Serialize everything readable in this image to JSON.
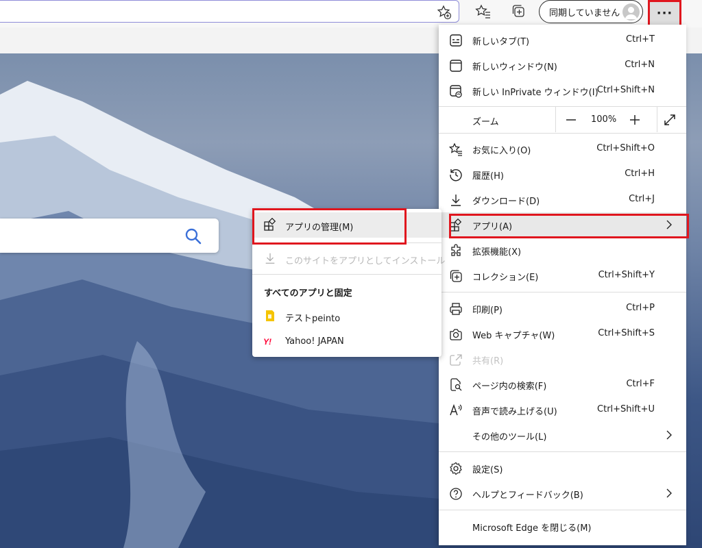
{
  "toolbar": {
    "profile_label": "同期していません",
    "more_label": "···"
  },
  "menu": {
    "new_tab": {
      "label": "新しいタブ(T)",
      "shortcut": "Ctrl+T"
    },
    "new_window": {
      "label": "新しいウィンドウ(N)",
      "shortcut": "Ctrl+N"
    },
    "new_inprivate": {
      "label": "新しい InPrivate ウィンドウ(I)",
      "shortcut": "Ctrl+Shift+N"
    },
    "zoom": {
      "label": "ズーム",
      "value": "100%"
    },
    "favorites": {
      "label": "お気に入り(O)",
      "shortcut": "Ctrl+Shift+O"
    },
    "history": {
      "label": "履歴(H)",
      "shortcut": "Ctrl+H"
    },
    "downloads": {
      "label": "ダウンロード(D)",
      "shortcut": "Ctrl+J"
    },
    "apps": {
      "label": "アプリ(A)"
    },
    "extensions": {
      "label": "拡張機能(X)"
    },
    "collections": {
      "label": "コレクション(E)",
      "shortcut": "Ctrl+Shift+Y"
    },
    "print": {
      "label": "印刷(P)",
      "shortcut": "Ctrl+P"
    },
    "web_capture": {
      "label": "Web キャプチャ(W)",
      "shortcut": "Ctrl+Shift+S"
    },
    "share": {
      "label": "共有(R)"
    },
    "find": {
      "label": "ページ内の検索(F)",
      "shortcut": "Ctrl+F"
    },
    "read_aloud": {
      "label": "音声で読み上げる(U)",
      "shortcut": "Ctrl+Shift+U"
    },
    "more_tools": {
      "label": "その他のツール(L)"
    },
    "settings": {
      "label": "設定(S)"
    },
    "help": {
      "label": "ヘルプとフィードバック(B)"
    },
    "close_edge": {
      "label": "Microsoft Edge を閉じる(M)"
    }
  },
  "submenu": {
    "manage_apps": "アプリの管理(M)",
    "install_site": "このサイトをアプリとしてインストール",
    "all_apps_heading": "すべてのアプリと固定",
    "apps": [
      {
        "label": "テストpeinto",
        "icon": "yellow-doc-icon"
      },
      {
        "label": "Yahoo! JAPAN",
        "icon": "yahoo-logo-icon"
      }
    ]
  },
  "colors": {
    "highlight": "#e0161e",
    "accent": "#3a6fd8"
  }
}
